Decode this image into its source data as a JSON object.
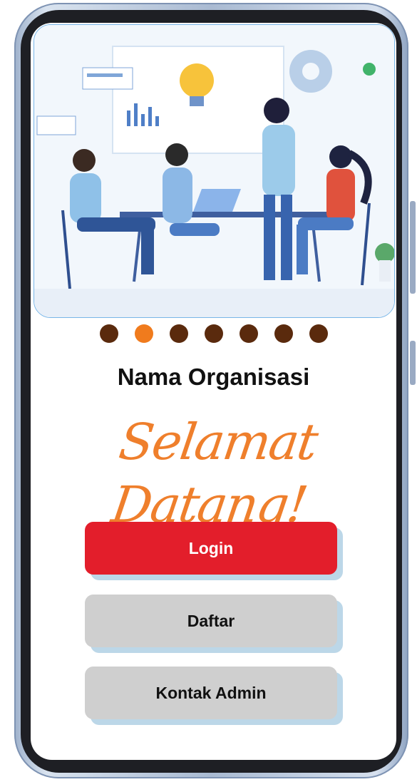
{
  "carousel": {
    "slide_count": 7,
    "active_index": 1,
    "dot_color": "#5a2a0d",
    "active_dot_color": "#f07b1d"
  },
  "header": {
    "org_name": "Nama Organisasi",
    "welcome": "Selamat Datang!"
  },
  "buttons": {
    "login": "Login",
    "daftar": "Daftar",
    "kontak_admin": "Kontak Admin"
  },
  "colors": {
    "primary": "#e31e2b",
    "secondary": "#cfcfcf",
    "accent": "#ef7f2c"
  },
  "hero": {
    "image": "team-meeting-illustration"
  }
}
